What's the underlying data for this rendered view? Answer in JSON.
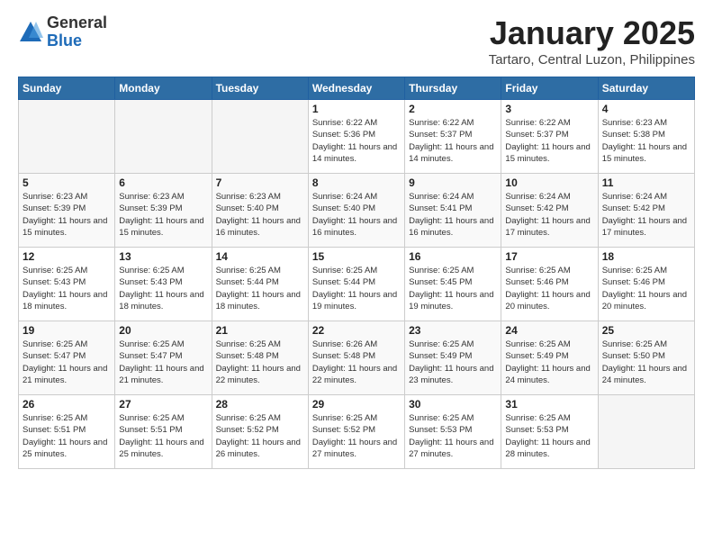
{
  "logo": {
    "general": "General",
    "blue": "Blue"
  },
  "title": "January 2025",
  "location": "Tartaro, Central Luzon, Philippines",
  "days_header": [
    "Sunday",
    "Monday",
    "Tuesday",
    "Wednesday",
    "Thursday",
    "Friday",
    "Saturday"
  ],
  "weeks": [
    [
      {
        "day": "",
        "info": ""
      },
      {
        "day": "",
        "info": ""
      },
      {
        "day": "",
        "info": ""
      },
      {
        "day": "1",
        "info": "Sunrise: 6:22 AM\nSunset: 5:36 PM\nDaylight: 11 hours\nand 14 minutes."
      },
      {
        "day": "2",
        "info": "Sunrise: 6:22 AM\nSunset: 5:37 PM\nDaylight: 11 hours\nand 14 minutes."
      },
      {
        "day": "3",
        "info": "Sunrise: 6:22 AM\nSunset: 5:37 PM\nDaylight: 11 hours\nand 15 minutes."
      },
      {
        "day": "4",
        "info": "Sunrise: 6:23 AM\nSunset: 5:38 PM\nDaylight: 11 hours\nand 15 minutes."
      }
    ],
    [
      {
        "day": "5",
        "info": "Sunrise: 6:23 AM\nSunset: 5:39 PM\nDaylight: 11 hours\nand 15 minutes."
      },
      {
        "day": "6",
        "info": "Sunrise: 6:23 AM\nSunset: 5:39 PM\nDaylight: 11 hours\nand 15 minutes."
      },
      {
        "day": "7",
        "info": "Sunrise: 6:23 AM\nSunset: 5:40 PM\nDaylight: 11 hours\nand 16 minutes."
      },
      {
        "day": "8",
        "info": "Sunrise: 6:24 AM\nSunset: 5:40 PM\nDaylight: 11 hours\nand 16 minutes."
      },
      {
        "day": "9",
        "info": "Sunrise: 6:24 AM\nSunset: 5:41 PM\nDaylight: 11 hours\nand 16 minutes."
      },
      {
        "day": "10",
        "info": "Sunrise: 6:24 AM\nSunset: 5:42 PM\nDaylight: 11 hours\nand 17 minutes."
      },
      {
        "day": "11",
        "info": "Sunrise: 6:24 AM\nSunset: 5:42 PM\nDaylight: 11 hours\nand 17 minutes."
      }
    ],
    [
      {
        "day": "12",
        "info": "Sunrise: 6:25 AM\nSunset: 5:43 PM\nDaylight: 11 hours\nand 18 minutes."
      },
      {
        "day": "13",
        "info": "Sunrise: 6:25 AM\nSunset: 5:43 PM\nDaylight: 11 hours\nand 18 minutes."
      },
      {
        "day": "14",
        "info": "Sunrise: 6:25 AM\nSunset: 5:44 PM\nDaylight: 11 hours\nand 18 minutes."
      },
      {
        "day": "15",
        "info": "Sunrise: 6:25 AM\nSunset: 5:44 PM\nDaylight: 11 hours\nand 19 minutes."
      },
      {
        "day": "16",
        "info": "Sunrise: 6:25 AM\nSunset: 5:45 PM\nDaylight: 11 hours\nand 19 minutes."
      },
      {
        "day": "17",
        "info": "Sunrise: 6:25 AM\nSunset: 5:46 PM\nDaylight: 11 hours\nand 20 minutes."
      },
      {
        "day": "18",
        "info": "Sunrise: 6:25 AM\nSunset: 5:46 PM\nDaylight: 11 hours\nand 20 minutes."
      }
    ],
    [
      {
        "day": "19",
        "info": "Sunrise: 6:25 AM\nSunset: 5:47 PM\nDaylight: 11 hours\nand 21 minutes."
      },
      {
        "day": "20",
        "info": "Sunrise: 6:25 AM\nSunset: 5:47 PM\nDaylight: 11 hours\nand 21 minutes."
      },
      {
        "day": "21",
        "info": "Sunrise: 6:25 AM\nSunset: 5:48 PM\nDaylight: 11 hours\nand 22 minutes."
      },
      {
        "day": "22",
        "info": "Sunrise: 6:26 AM\nSunset: 5:48 PM\nDaylight: 11 hours\nand 22 minutes."
      },
      {
        "day": "23",
        "info": "Sunrise: 6:25 AM\nSunset: 5:49 PM\nDaylight: 11 hours\nand 23 minutes."
      },
      {
        "day": "24",
        "info": "Sunrise: 6:25 AM\nSunset: 5:49 PM\nDaylight: 11 hours\nand 24 minutes."
      },
      {
        "day": "25",
        "info": "Sunrise: 6:25 AM\nSunset: 5:50 PM\nDaylight: 11 hours\nand 24 minutes."
      }
    ],
    [
      {
        "day": "26",
        "info": "Sunrise: 6:25 AM\nSunset: 5:51 PM\nDaylight: 11 hours\nand 25 minutes."
      },
      {
        "day": "27",
        "info": "Sunrise: 6:25 AM\nSunset: 5:51 PM\nDaylight: 11 hours\nand 25 minutes."
      },
      {
        "day": "28",
        "info": "Sunrise: 6:25 AM\nSunset: 5:52 PM\nDaylight: 11 hours\nand 26 minutes."
      },
      {
        "day": "29",
        "info": "Sunrise: 6:25 AM\nSunset: 5:52 PM\nDaylight: 11 hours\nand 27 minutes."
      },
      {
        "day": "30",
        "info": "Sunrise: 6:25 AM\nSunset: 5:53 PM\nDaylight: 11 hours\nand 27 minutes."
      },
      {
        "day": "31",
        "info": "Sunrise: 6:25 AM\nSunset: 5:53 PM\nDaylight: 11 hours\nand 28 minutes."
      },
      {
        "day": "",
        "info": ""
      }
    ]
  ]
}
